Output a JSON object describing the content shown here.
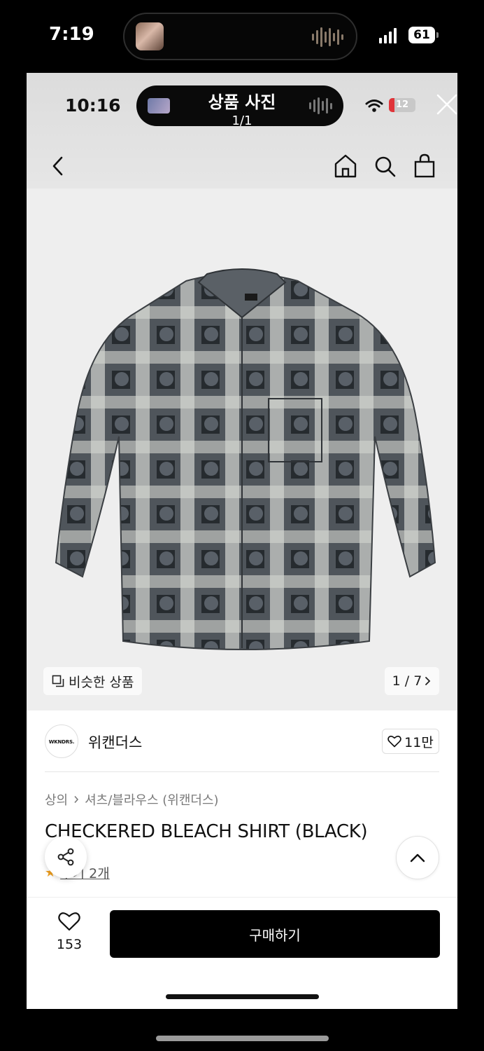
{
  "outer_status": {
    "time": "7:19",
    "battery": "61"
  },
  "inner_status": {
    "time": "10:16",
    "battery": "12"
  },
  "viewer": {
    "title": "상품 사진",
    "counter": "1/1"
  },
  "nav": {
    "icons": [
      "chevron-left-icon",
      "home-icon",
      "search-icon",
      "shopping-bag-icon"
    ]
  },
  "gallery": {
    "similar_label": "비슷한 상품",
    "counter": "1 / 7"
  },
  "brand": {
    "logo_text": "WKNDRS.",
    "name": "위캔더스",
    "likes": "11만"
  },
  "product": {
    "breadcrumb": [
      "상의",
      "셔츠/블라우스 (위캔더스)"
    ],
    "title": "CHECKERED BLEACH SHIRT (BLACK)",
    "review_text": "후기 2개"
  },
  "bottom": {
    "wish_count": "153",
    "buy_label": "구매하기"
  },
  "colors": {
    "buy_button": "#000000",
    "background": "#ffffff",
    "image_bg": "#eeeeee"
  }
}
